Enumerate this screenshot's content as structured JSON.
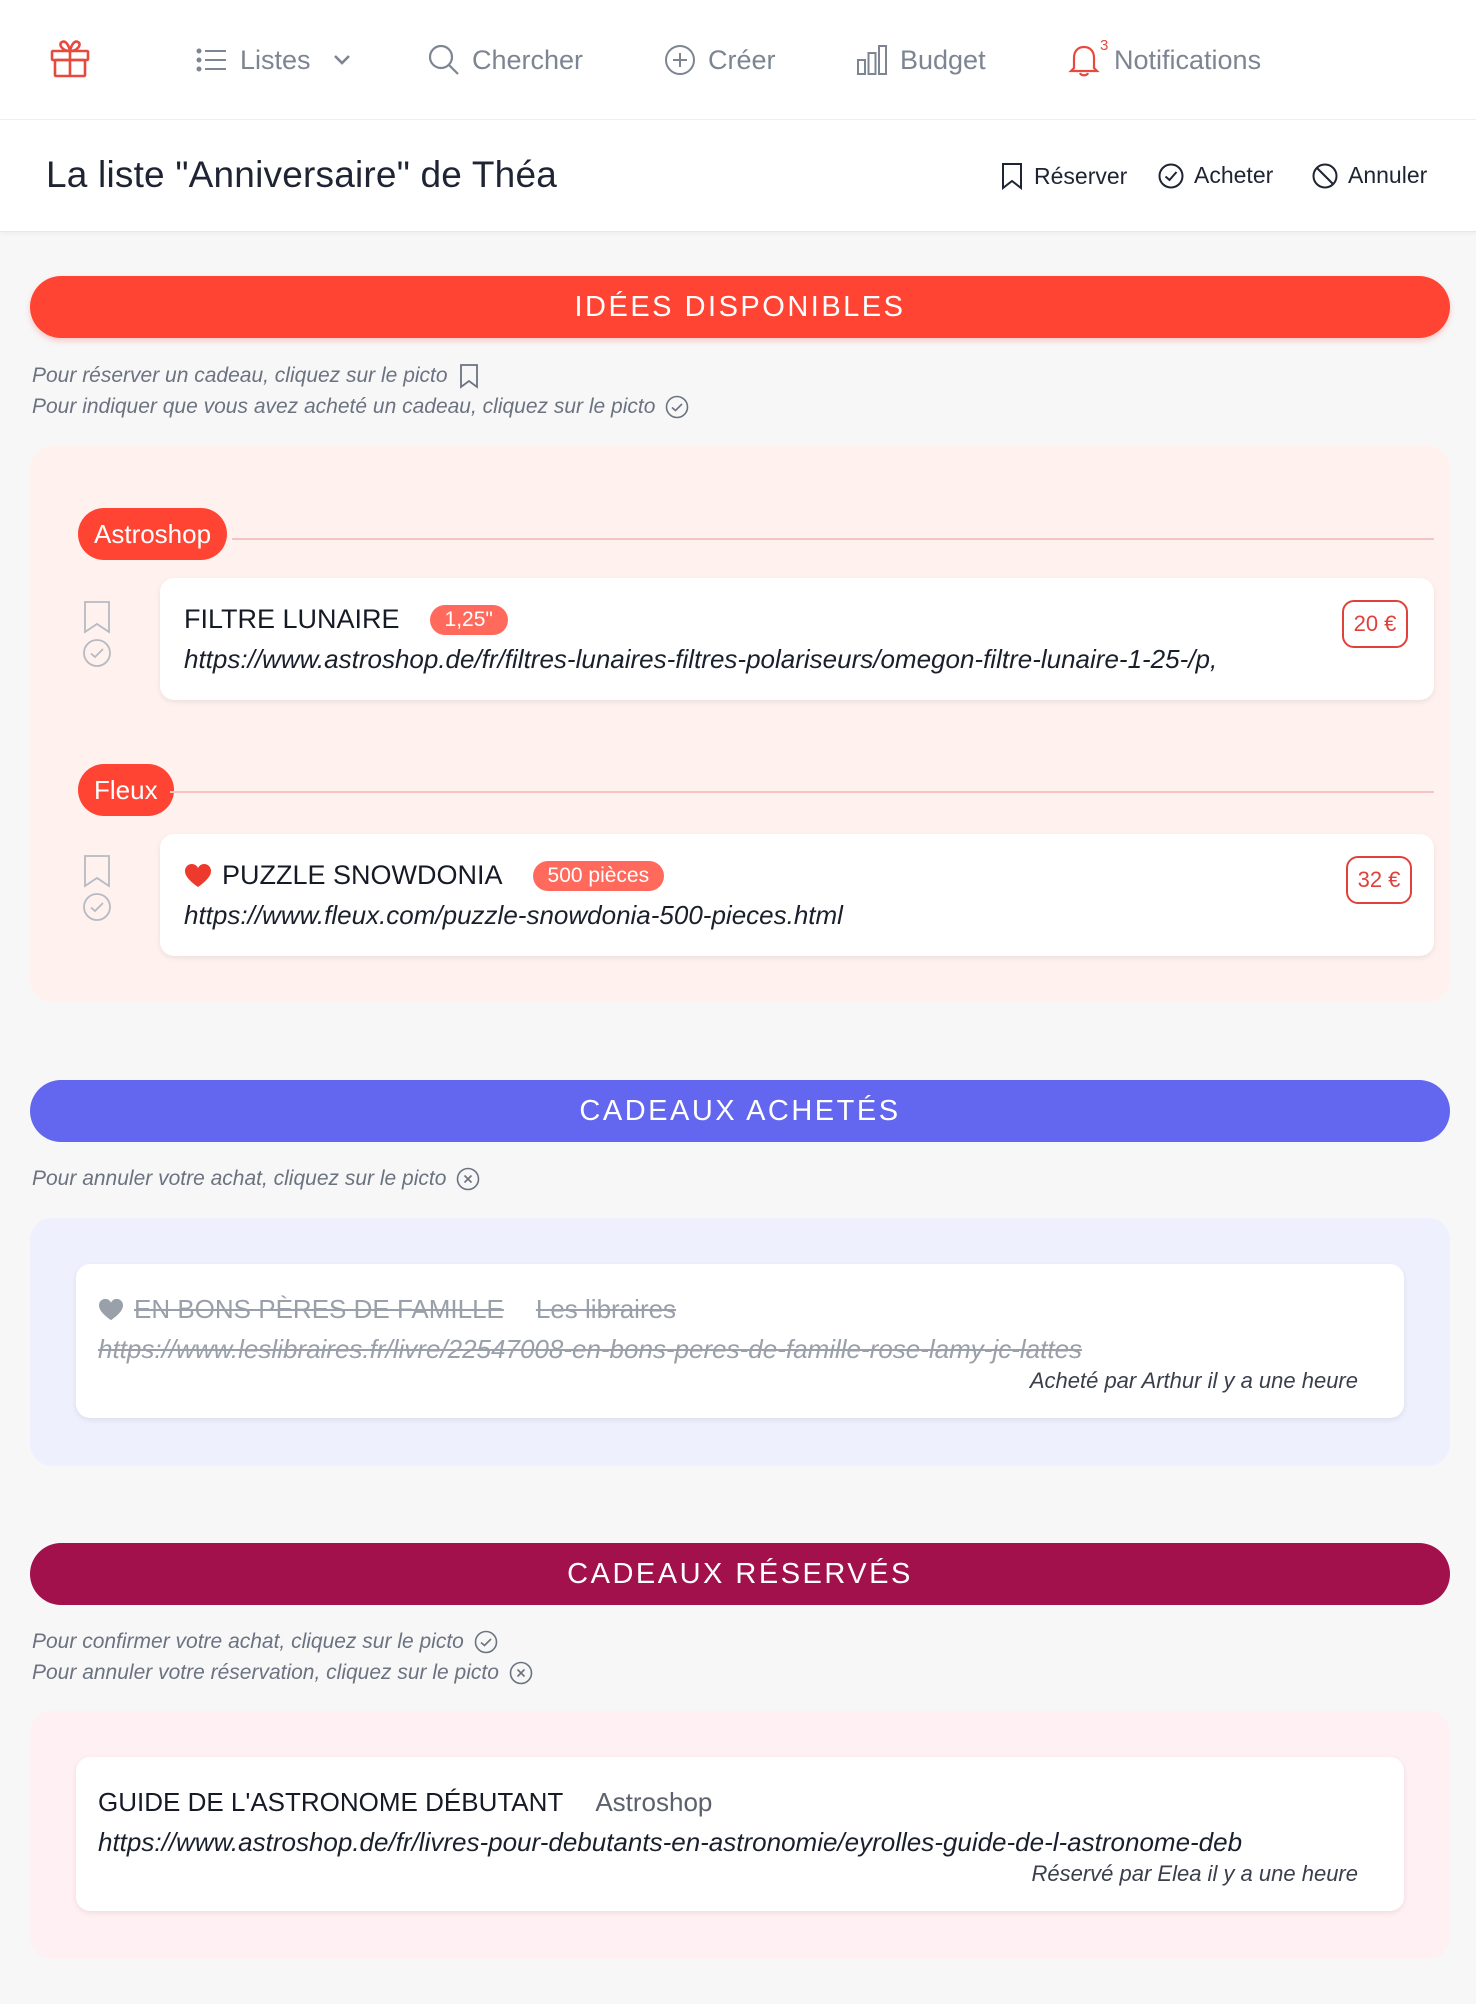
{
  "nav": {
    "logo_icon": "gift-icon",
    "listes": "Listes",
    "chercher": "Chercher",
    "creer": "Créer",
    "budget": "Budget",
    "notifications": "Notifications",
    "notif_count": "3"
  },
  "header": {
    "title": "La liste \"Anniversaire\" de Théa",
    "actions": {
      "reserver": "Réserver",
      "acheter": "Acheter",
      "annuler": "Annuler"
    }
  },
  "sections": {
    "idees": {
      "banner": "IDÉES DISPONIBLES",
      "hint1": "Pour réserver un cadeau, cliquez sur le picto",
      "hint2": "Pour indiquer que vous avez acheté un cadeau, cliquez sur le picto",
      "groups": [
        {
          "shop": "Astroshop",
          "item": {
            "title": "FILTRE LUNAIRE",
            "tag": "1,25\"",
            "url": "https://www.astroshop.de/fr/filtres-lunaires-filtres-polariseurs/omegon-filtre-lunaire-1-25-/p,",
            "price": "20 €",
            "favorite": false
          }
        },
        {
          "shop": "Fleux",
          "item": {
            "title": "PUZZLE SNOWDONIA",
            "tag": "500 pièces",
            "url": "https://www.fleux.com/puzzle-snowdonia-500-pieces.html",
            "price": "32 €",
            "favorite": true
          }
        }
      ]
    },
    "achetes": {
      "banner": "CADEAUX ACHETÉS",
      "hint1": "Pour annuler votre achat, cliquez sur le picto",
      "item": {
        "title": "EN BONS PÈRES DE FAMILLE",
        "shop": "Les libraires",
        "url": "https://www.leslibraires.fr/livre/22547008-en-bons-peres-de-famille-rose-lamy-jc-lattes",
        "meta": "Acheté par Arthur il y a une heure"
      }
    },
    "reserves": {
      "banner": "CADEAUX RÉSERVÉS",
      "hint1": "Pour confirmer votre achat, cliquez sur le picto",
      "hint2": "Pour annuler votre réservation, cliquez sur le picto",
      "item": {
        "title": "GUIDE DE L'ASTRONOME DÉBUTANT",
        "shop": "Astroshop",
        "url": "https://www.astroshop.de/fr/livres-pour-debutants-en-astronomie/eyrolles-guide-de-l-astronome-deb",
        "meta": "Réservé par Elea il y a une heure"
      }
    }
  },
  "colors": {
    "accent_red": "#ff4433",
    "accent_indigo": "#6366ef",
    "accent_crimson": "#a3114d"
  }
}
